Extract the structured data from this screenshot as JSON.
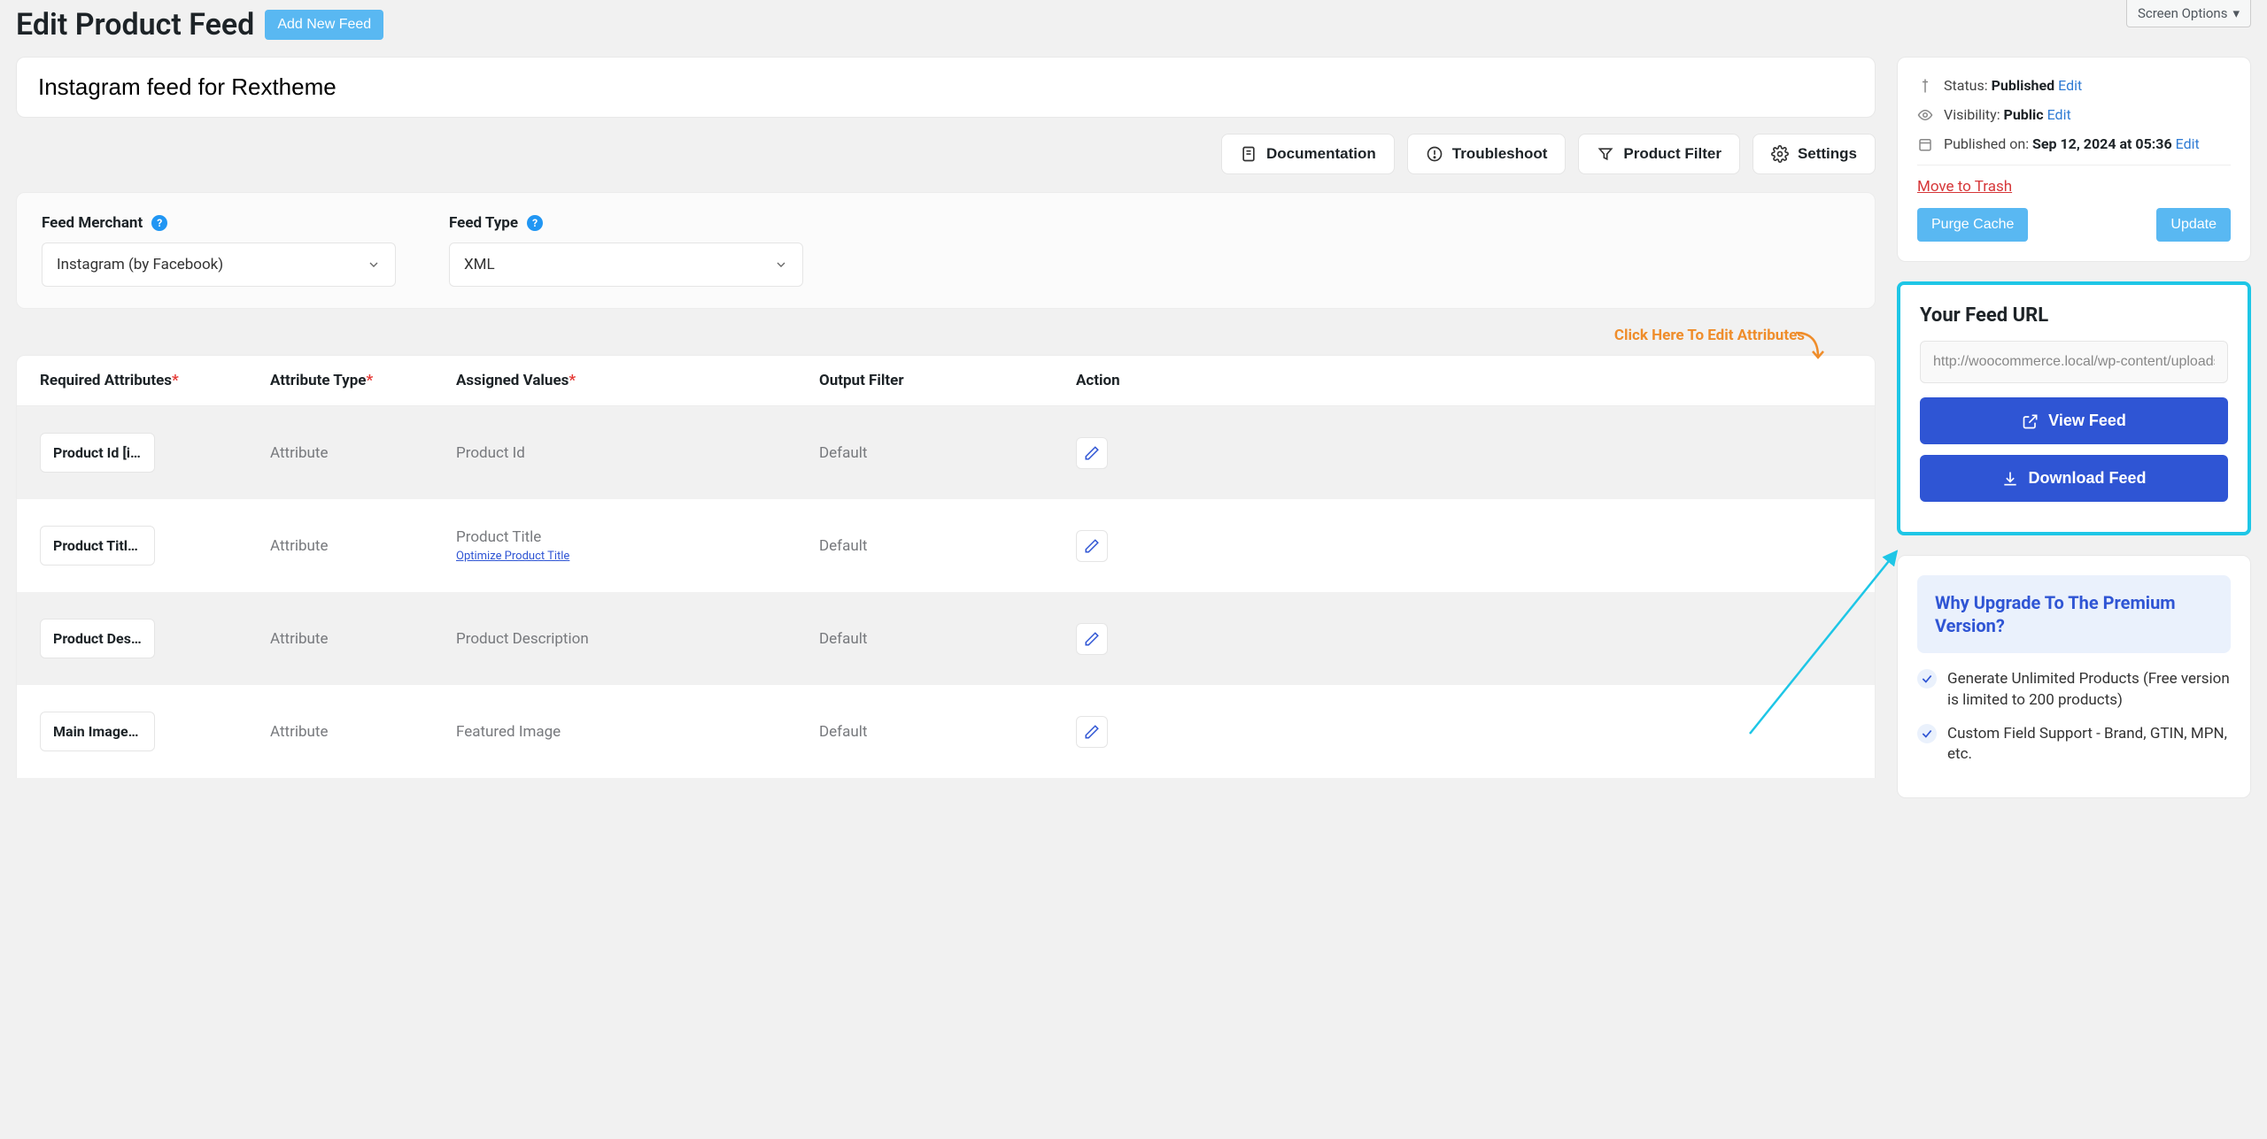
{
  "header": {
    "page_title": "Edit Product Feed",
    "add_new_label": "Add New Feed",
    "screen_options_label": "Screen Options"
  },
  "feed_title": "Instagram feed for Rextheme",
  "toolbar": {
    "documentation": "Documentation",
    "troubleshoot": "Troubleshoot",
    "product_filter": "Product Filter",
    "settings": "Settings"
  },
  "merchant_panel": {
    "feed_merchant_label": "Feed Merchant",
    "feed_merchant_value": "Instagram (by Facebook)",
    "feed_type_label": "Feed Type",
    "feed_type_value": "XML"
  },
  "edit_attr_hint": "Click Here To Edit Attributes",
  "attr_table": {
    "headers": {
      "required_attributes": "Required Attributes",
      "attribute_type": "Attribute Type",
      "assigned_values": "Assigned Values",
      "output_filter": "Output Filter",
      "action": "Action"
    },
    "rows": [
      {
        "attr": "Product Id [id]",
        "type": "Attribute",
        "value": "Product Id",
        "sub_link": "",
        "filter": "Default"
      },
      {
        "attr": "Product Title …",
        "type": "Attribute",
        "value": "Product Title",
        "sub_link": "Optimize Product Title",
        "filter": "Default"
      },
      {
        "attr": "Product Desc…",
        "type": "Attribute",
        "value": "Product Description",
        "sub_link": "",
        "filter": "Default"
      },
      {
        "attr": "Main Image […",
        "type": "Attribute",
        "value": "Featured Image",
        "sub_link": "",
        "filter": "Default"
      }
    ]
  },
  "publish_box": {
    "status_label": "Status:",
    "status_value": "Published",
    "visibility_label": "Visibility:",
    "visibility_value": "Public",
    "published_on_label": "Published on:",
    "published_on_value": "Sep 12, 2024 at 05:36",
    "edit_link": "Edit",
    "trash_label": "Move to Trash",
    "purge_cache_label": "Purge Cache",
    "update_label": "Update"
  },
  "feed_url_box": {
    "title": "Your Feed URL",
    "url_value": "http://woocommerce.local/wp-content/uploads",
    "view_feed_label": "View Feed",
    "download_feed_label": "Download Feed"
  },
  "upgrade_box": {
    "title": "Why Upgrade To The Premium Version?",
    "items": [
      "Generate Unlimited Products (Free version is limited to 200 products)",
      "Custom Field Support - Brand, GTIN, MPN, etc."
    ]
  }
}
